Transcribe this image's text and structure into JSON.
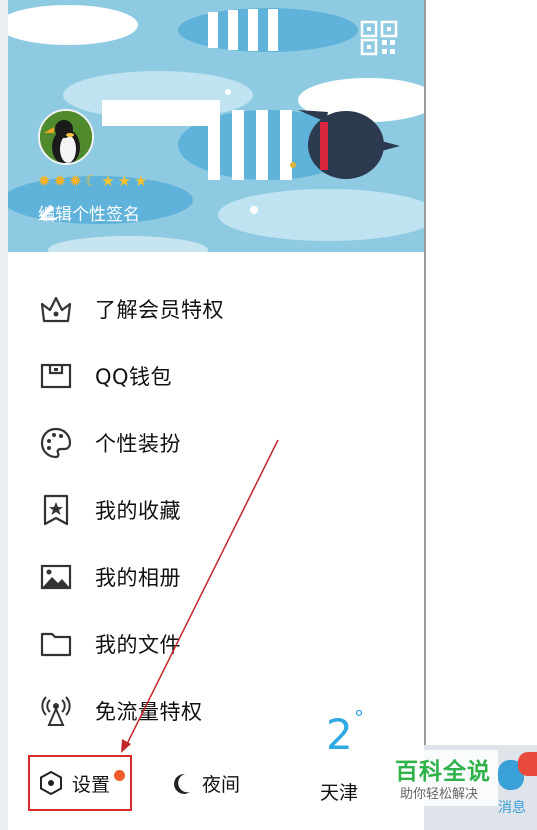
{
  "header": {
    "signature": "编辑个性签名",
    "qr_icon": "qr-code-icon",
    "level_icons": [
      "sun-icon",
      "sun-icon",
      "sun-icon",
      "moon-icon",
      "star-icon",
      "star-icon",
      "star-icon"
    ]
  },
  "menu": {
    "items": [
      {
        "label": "了解会员特权",
        "icon": "crown-icon"
      },
      {
        "label": "QQ钱包",
        "icon": "wallet-icon"
      },
      {
        "label": "个性装扮",
        "icon": "palette-icon"
      },
      {
        "label": "我的收藏",
        "icon": "bookmark-star-icon"
      },
      {
        "label": "我的相册",
        "icon": "photo-icon"
      },
      {
        "label": "我的文件",
        "icon": "folder-icon"
      },
      {
        "label": "免流量特权",
        "icon": "signal-tower-icon"
      }
    ]
  },
  "bottom": {
    "settings_label": "设置",
    "night_label": "夜间",
    "city": "天津",
    "temperature": "2",
    "degree": "°"
  },
  "right_panel": {
    "messages_label": "消息"
  },
  "watermark": {
    "title": "百科全说",
    "subtitle": "助你轻松解决"
  },
  "colors": {
    "header_bg": "#8ecbe3",
    "accent_blue": "#30a9e4",
    "highlight_red": "#d62b2b",
    "badge_orange": "#ef5b2b",
    "watermark_green": "#2fb24a"
  }
}
